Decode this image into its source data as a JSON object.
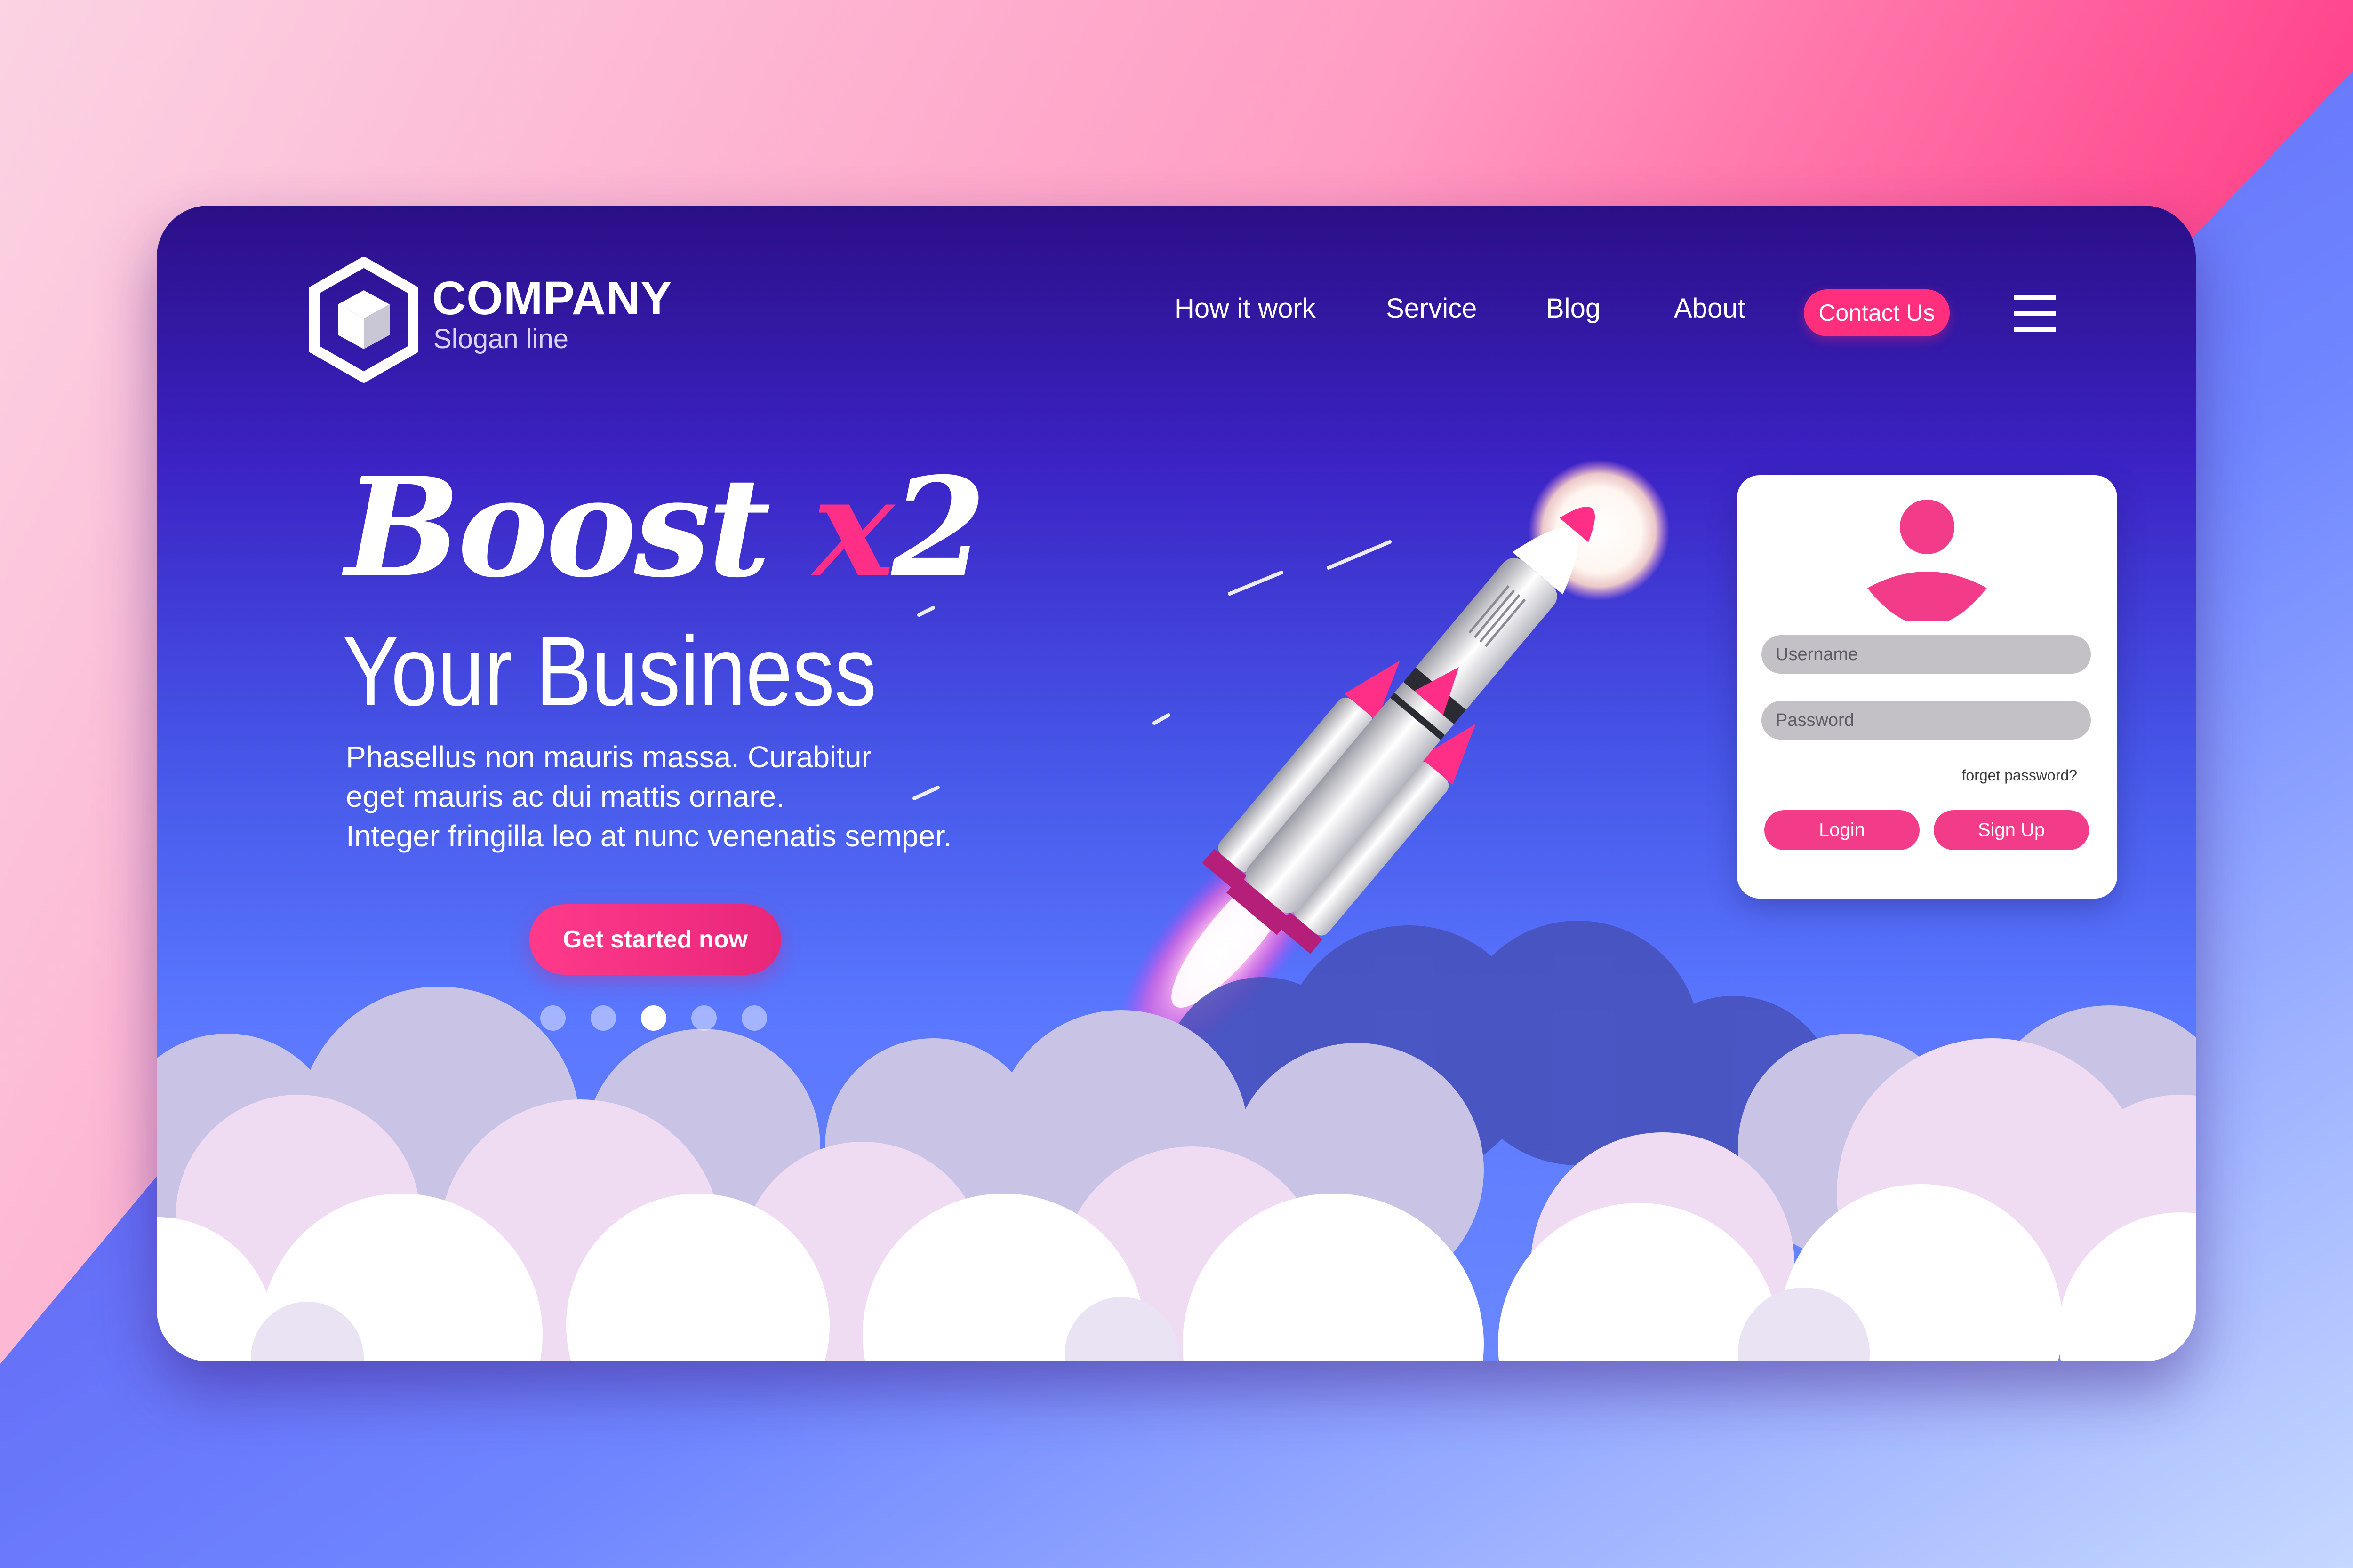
{
  "brand": {
    "name": "COMPANY",
    "slogan": "Slogan line",
    "logo_icon": "hexagon-cube-icon"
  },
  "nav": {
    "items": [
      {
        "label": "How it work"
      },
      {
        "label": "Service"
      },
      {
        "label": "Blog"
      },
      {
        "label": "About"
      }
    ],
    "contact_label": "Contact Us",
    "menu_icon": "hamburger-menu-icon"
  },
  "hero": {
    "title_word": "Boost",
    "title_accent": "x",
    "title_number": "2",
    "subtitle": "Your Business",
    "description": [
      "Phasellus non mauris massa.  Curabitur",
      "eget mauris ac dui mattis ornare.",
      "Integer fringilla leo at nunc venenatis semper."
    ],
    "cta_label": "Get started now"
  },
  "carousel": {
    "count": 5,
    "active_index": 2
  },
  "login": {
    "avatar_icon": "user-avatar-icon",
    "username_placeholder": "Username",
    "password_placeholder": "Password",
    "forget_label": "forget password?",
    "login_label": "Login",
    "signup_label": "Sign Up"
  },
  "colors": {
    "accent_pink": "#ff2f7e",
    "deep_purple": "#2b0f86",
    "mid_blue": "#4657e8",
    "cloud_white": "#ffffff",
    "cloud_lilac": "#f1dcf3"
  }
}
